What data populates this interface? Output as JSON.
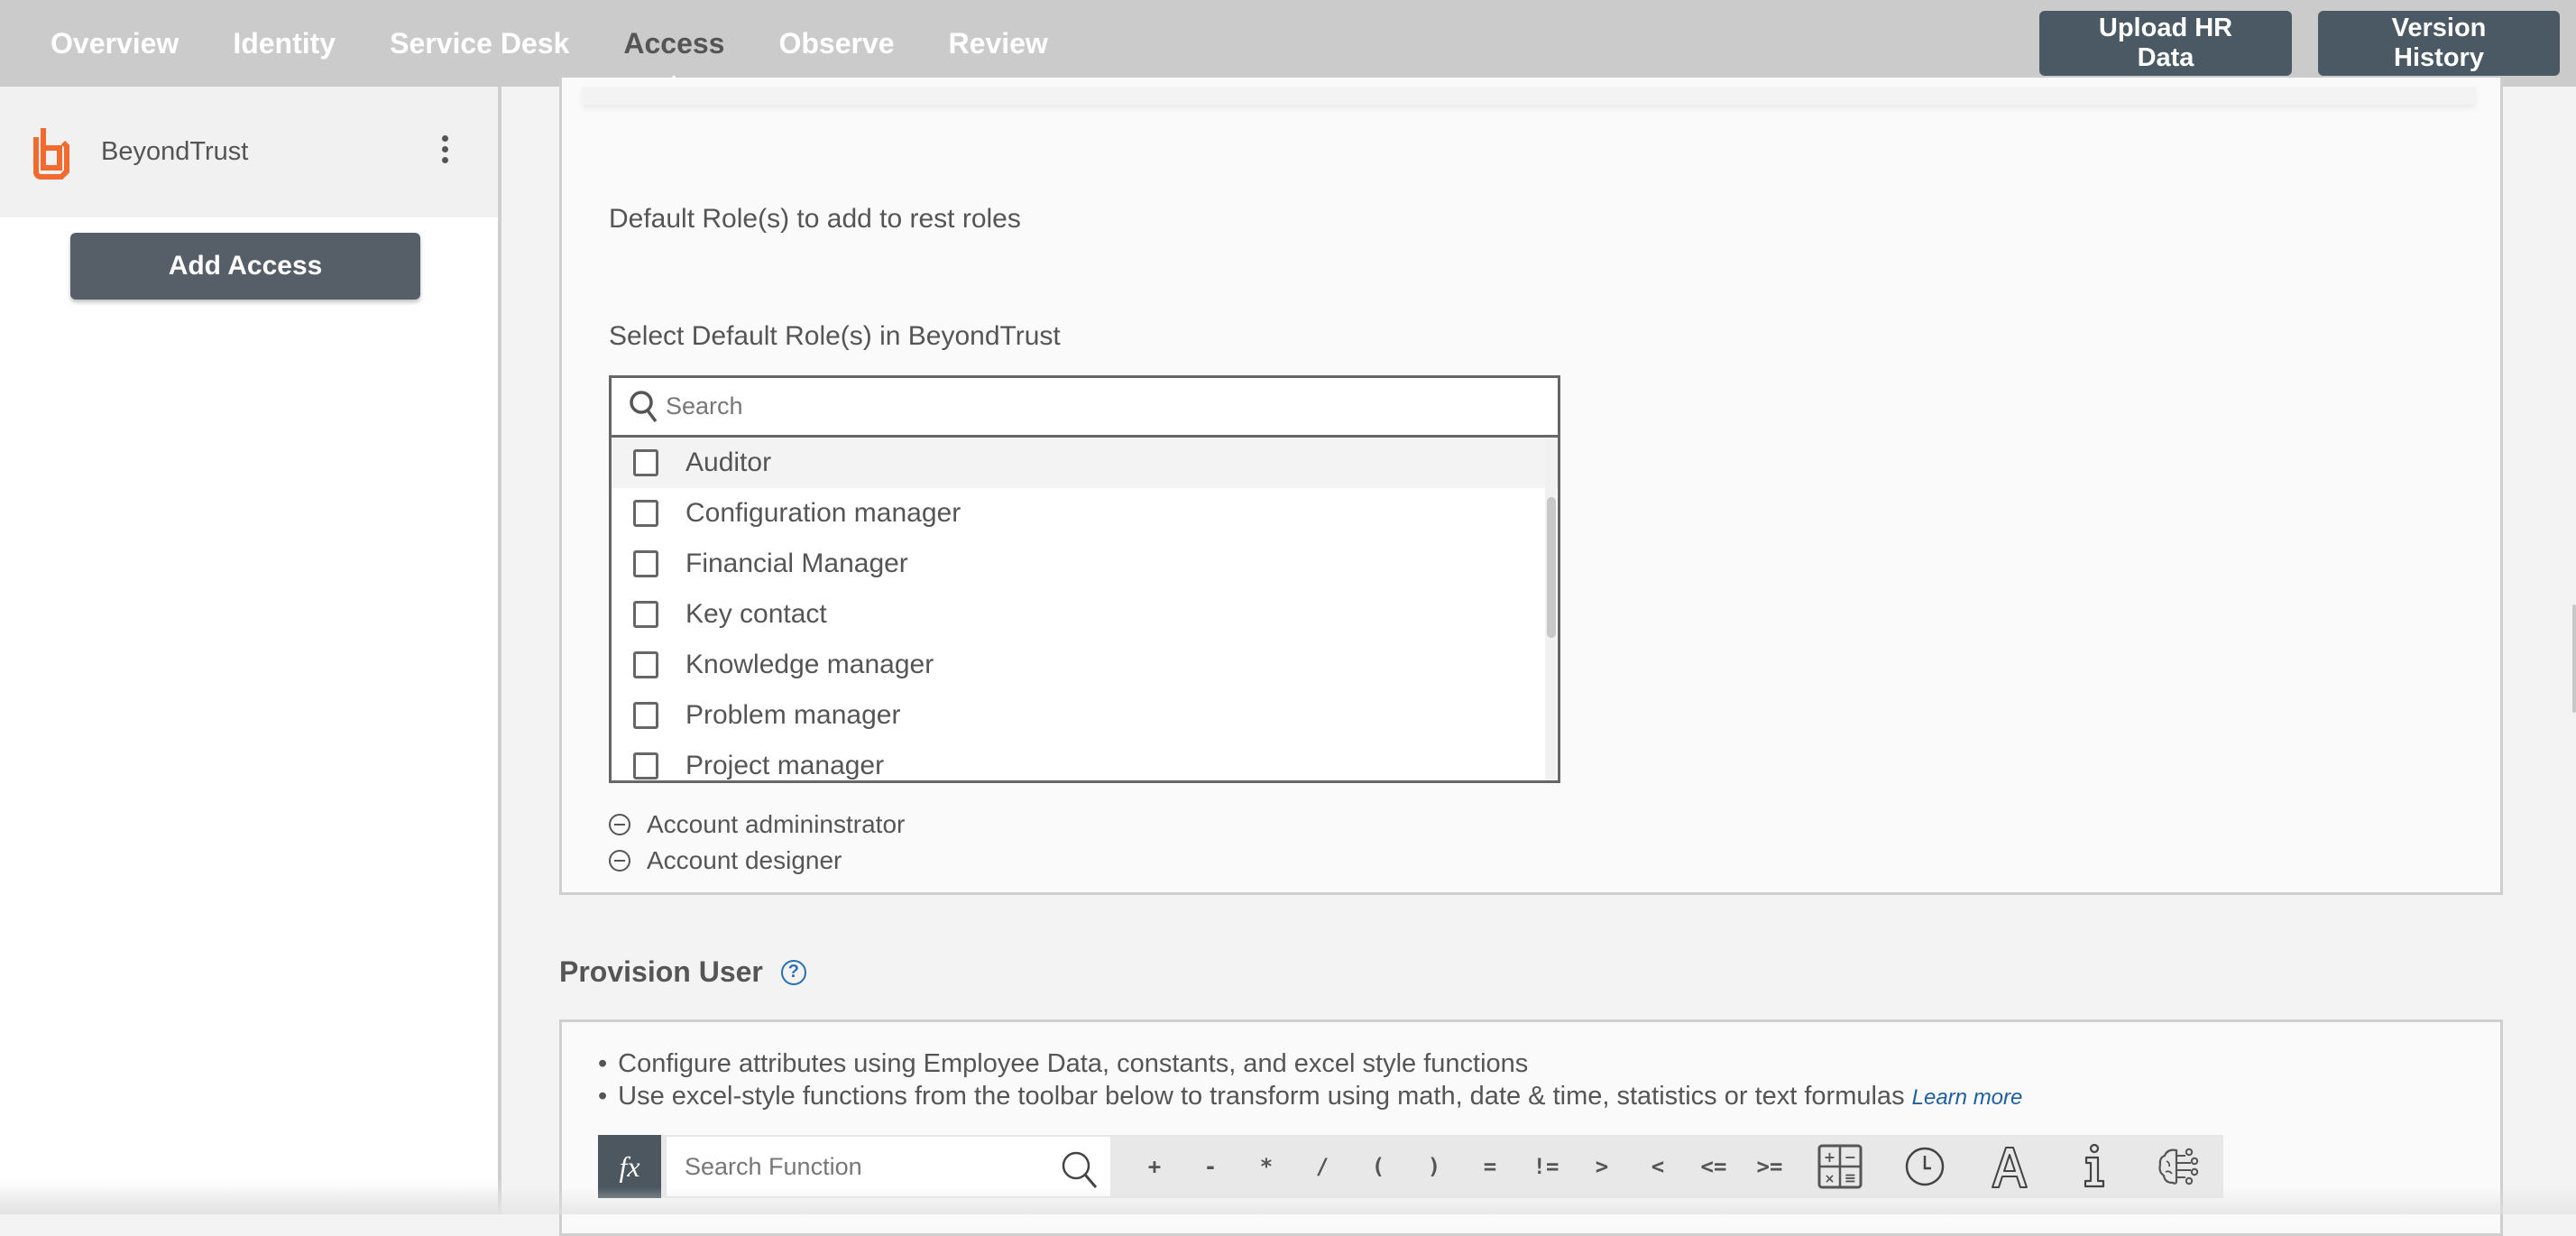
{
  "nav": {
    "tabs": [
      {
        "label": "Overview",
        "active": false
      },
      {
        "label": "Identity",
        "active": false
      },
      {
        "label": "Service Desk",
        "active": false
      },
      {
        "label": "Access",
        "active": true
      },
      {
        "label": "Observe",
        "active": false
      },
      {
        "label": "Review",
        "active": false
      }
    ],
    "upload_label": "Upload HR Data",
    "version_label": "Version History"
  },
  "sidebar": {
    "app_name": "BeyondTrust",
    "logo_color": "#f26a2e",
    "add_access_label": "Add Access"
  },
  "roles_section": {
    "default_roles_label": "Default Role(s) to add to rest roles",
    "select_label": "Select Default Role(s) in BeyondTrust",
    "search_placeholder": "Search",
    "options": [
      {
        "label": "Auditor",
        "checked": false
      },
      {
        "label": "Configuration manager",
        "checked": false
      },
      {
        "label": "Financial Manager",
        "checked": false
      },
      {
        "label": "Key contact",
        "checked": false
      },
      {
        "label": "Knowledge manager",
        "checked": false
      },
      {
        "label": "Problem manager",
        "checked": false
      },
      {
        "label": "Project manager",
        "checked": false
      }
    ],
    "selected": [
      {
        "label": "Account admininstrator"
      },
      {
        "label": "Account designer"
      }
    ]
  },
  "provision": {
    "title": "Provision User",
    "help_glyph": "?",
    "bullets": [
      "Configure attributes using Employee Data, constants, and excel style functions",
      "Use excel-style functions from the toolbar below to transform using math, date & time, statistics or text formulas"
    ],
    "learn_more": "Learn more",
    "toolbar": {
      "fx_label": "fx",
      "search_placeholder": "Search Function",
      "operators": [
        "+",
        "-",
        "*",
        "/",
        "(",
        ")",
        "=",
        "!=",
        ">",
        "<",
        "<=",
        ">="
      ],
      "tools": [
        "math-functions-icon",
        "date-time-icon",
        "text-functions-icon",
        "info-icon",
        "ai-brain-icon"
      ]
    }
  },
  "colors": {
    "nav_bg": "#cbcbcb",
    "button_bg": "#4a5963",
    "accent_link": "#1f5f9f"
  }
}
